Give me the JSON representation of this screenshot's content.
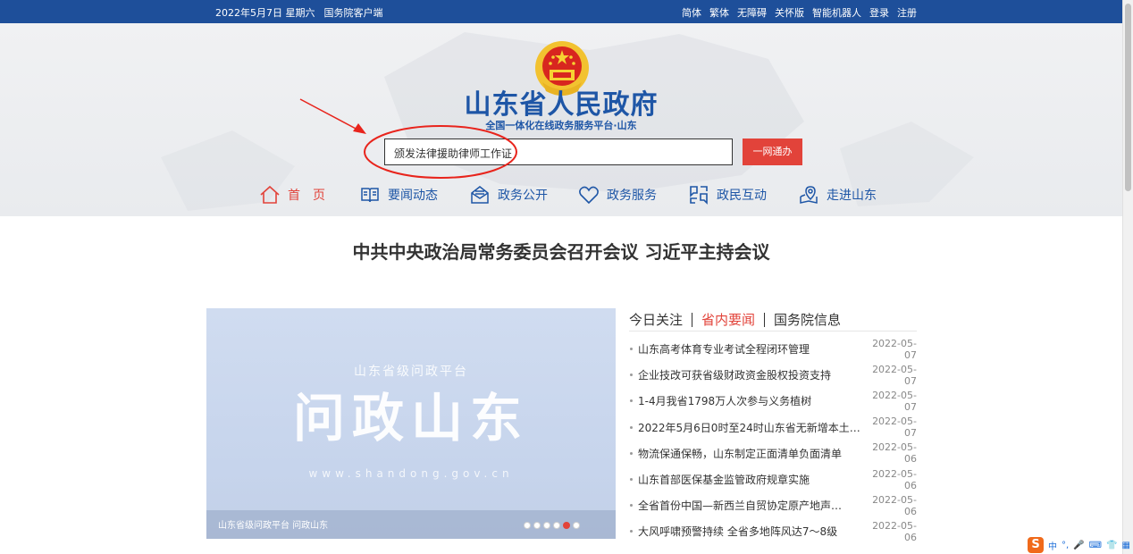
{
  "topbar": {
    "date": "2022年5月7日 星期六",
    "client": "国务院客户端",
    "links": [
      "简体",
      "繁体",
      "无障碍",
      "关怀版",
      "智能机器人",
      "登录",
      "注册"
    ]
  },
  "header": {
    "title": "山东省人民政府",
    "subtitle": "全国一体化在线政务服务平台·山东",
    "search_value": "颁发法律援助律师工作证",
    "search_button": "一网通办"
  },
  "nav": [
    {
      "label": "首　页",
      "icon": "home-icon"
    },
    {
      "label": "要闻动态",
      "icon": "book-icon"
    },
    {
      "label": "政务公开",
      "icon": "mail-open-icon"
    },
    {
      "label": "政务服务",
      "icon": "heart-icon"
    },
    {
      "label": "政民互动",
      "icon": "interact-icon"
    },
    {
      "label": "走进山东",
      "icon": "map-pin-icon"
    }
  ],
  "headline": "中共中央政治局常务委员会召开会议 习近平主持会议",
  "banner": {
    "top_text": "山东省级问政平台",
    "big_text": "问政山东",
    "url_text": "www.shandong.gov.cn",
    "caption": "山东省级问政平台 问政山东",
    "slides": 6,
    "active_slide": 5
  },
  "news": {
    "tabs": [
      "今日关注",
      "省内要闻",
      "国务院信息"
    ],
    "active_tab": 1,
    "items": [
      {
        "title": "山东高考体育专业考试全程闭环管理",
        "date": "2022-05-07"
      },
      {
        "title": "企业技改可获省级财政资金股权投资支持",
        "date": "2022-05-07"
      },
      {
        "title": "1-4月我省1798万人次参与义务植树",
        "date": "2022-05-07"
      },
      {
        "title": "2022年5月6日0时至24时山东省无新增本土…",
        "date": "2022-05-07"
      },
      {
        "title": "物流保通保畅，山东制定正面清单负面清单",
        "date": "2022-05-06"
      },
      {
        "title": "山东首部医保基金监管政府规章实施",
        "date": "2022-05-06"
      },
      {
        "title": "全省首份中国—新西兰自贸协定原产地声…",
        "date": "2022-05-06"
      },
      {
        "title": "大风呼啸预警持续 全省多地阵风达7～8级",
        "date": "2022-05-06"
      }
    ]
  },
  "ime": {
    "logo": "S",
    "lang": "中"
  },
  "colors": {
    "brand_blue": "#1e56a6",
    "topbar": "#1e4f9a",
    "accent_red": "#e2433a"
  }
}
